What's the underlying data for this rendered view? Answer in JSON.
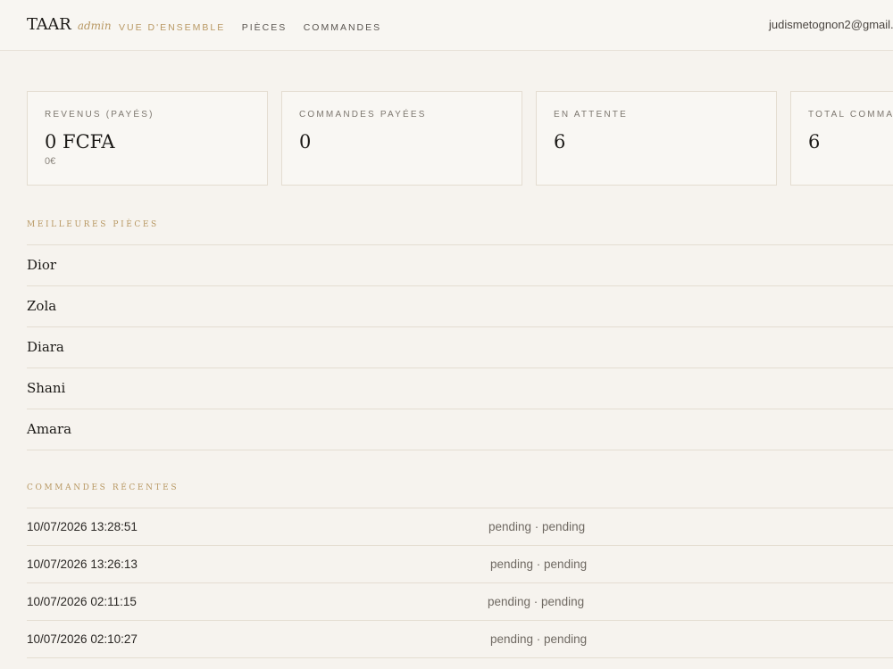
{
  "brand": {
    "name": "TAAR",
    "sub": "admin"
  },
  "nav": [
    {
      "label": "VUE D'ENSEMBLE",
      "active": true
    },
    {
      "label": "PIÈCES",
      "active": false
    },
    {
      "label": "COMMANDES",
      "active": false
    }
  ],
  "user": {
    "email": "judismetognon2@gmail."
  },
  "stats": [
    {
      "label": "REVENUS (PAYÉS)",
      "value": "0 FCFA",
      "note": "0€"
    },
    {
      "label": "COMMANDES PAYÉES",
      "value": "0"
    },
    {
      "label": "EN ATTENTE",
      "value": "6"
    },
    {
      "label": "TOTAL COMMA",
      "value": "6"
    }
  ],
  "top_pieces": {
    "title": "MEILLEURES PIÈCES",
    "items": [
      "Dior",
      "Zola",
      "Diara",
      "Shani",
      "Amara"
    ]
  },
  "recent_orders": {
    "title": "COMMANDES RÉCENTES",
    "items": [
      {
        "date": "10/07/2026 13:28:51",
        "status": "pending · pending"
      },
      {
        "date": "10/07/2026 13:26:13",
        "status": "pending · pending"
      },
      {
        "date": "10/07/2026 02:11:15",
        "status": "pending · pending"
      },
      {
        "date": "10/07/2026 02:10:27",
        "status": "pending · pending"
      }
    ]
  },
  "colors": {
    "accent": "#b89863",
    "background": "#f6f3ee",
    "text": "#1c1a17",
    "border": "#e4ddd1"
  }
}
